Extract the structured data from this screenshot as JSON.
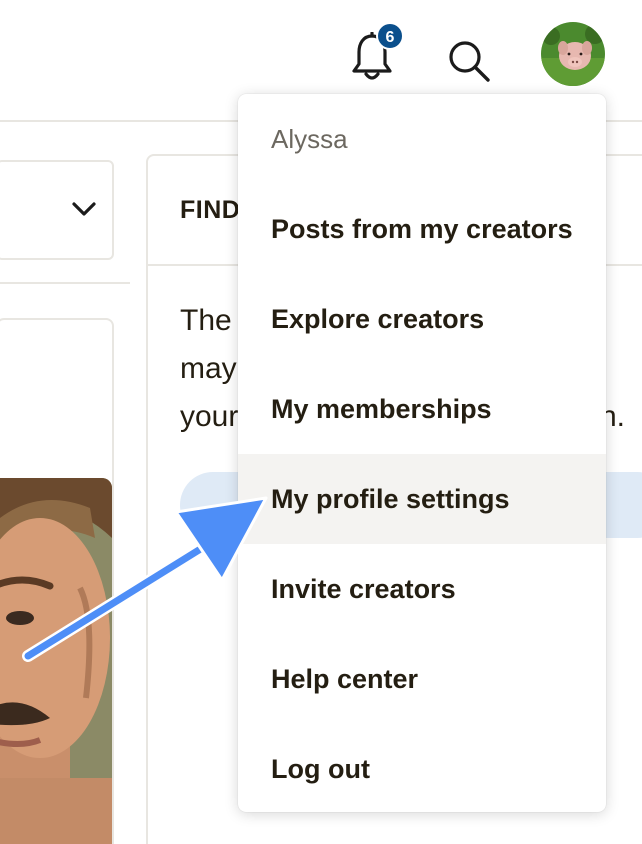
{
  "header": {
    "notification_count": "6",
    "icons": [
      "bell-icon",
      "search-icon",
      "avatar"
    ]
  },
  "right_card": {
    "title_fragment": "FIND",
    "body_fragments": [
      "The",
      "may",
      "your",
      "n."
    ]
  },
  "menu": {
    "user_name": "Alyssa",
    "items": [
      {
        "label": "Posts from my creators"
      },
      {
        "label": "Explore creators"
      },
      {
        "label": "My memberships"
      },
      {
        "label": "My profile settings",
        "highlighted": true
      },
      {
        "label": "Invite creators"
      },
      {
        "label": "Help center"
      },
      {
        "label": "Log out"
      }
    ]
  },
  "colors": {
    "badge": "#0b4f8c",
    "highlight": "#f4f3f1",
    "annotation_arrow": "#4e8ef7",
    "pill": "#dfeaf6"
  }
}
